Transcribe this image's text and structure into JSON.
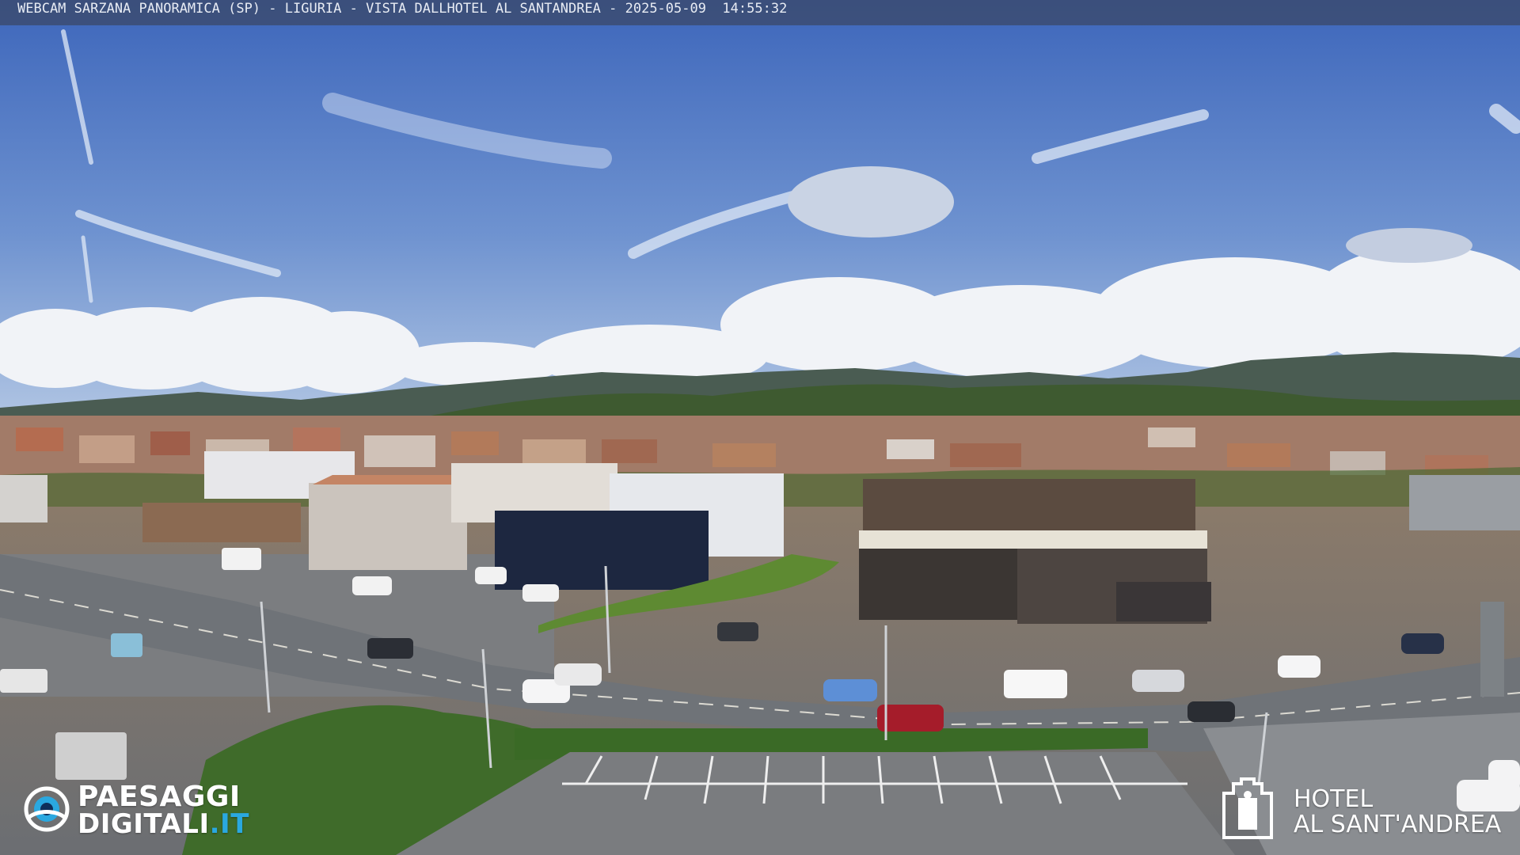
{
  "overlay": {
    "caption": "WEBCAM SARZANA PANORAMICA (SP) - LIGURIA - VISTA DALLHOTEL AL SANTANDREA - 2025-05-09  14:55:32"
  },
  "watermarks": {
    "left_line1": "PAESAGGI",
    "left_line2": "DIGITALI",
    "left_suffix": ".IT",
    "right_line1": "HOTEL",
    "right_line2": "AL SANT'ANDREA"
  },
  "scene": {
    "sky_top": "#3f68bd",
    "sky_bottom": "#9db6dc",
    "hills": "#3d4e3a",
    "road": "#6f7378",
    "grass": "#3f6b2a",
    "accent_blue": "#2aa8e0"
  }
}
